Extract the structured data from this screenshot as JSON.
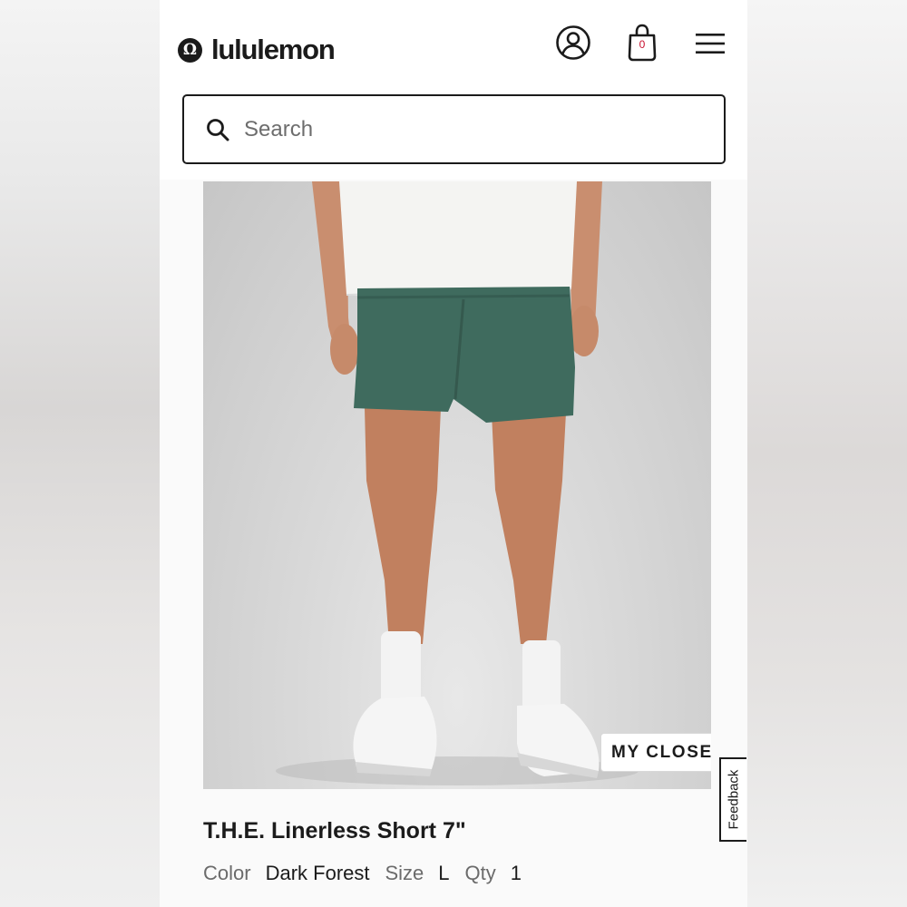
{
  "header": {
    "logo_mark": "Ω",
    "logo_text": "lululemon",
    "icons": [
      "account-icon",
      "bag-icon",
      "menu-icon"
    ],
    "bag_count": "0",
    "bag_count_color": "#c8102e"
  },
  "search": {
    "placeholder": "Search",
    "value": ""
  },
  "product": {
    "image_alt": "T.H.E. Linerless Short 7\"",
    "my_closet_label": "MY CLOSET",
    "title": "T.H.E. Linerless Short 7\"",
    "color_label": "Color",
    "color_value": "Dark Forest",
    "size_label": "Size",
    "size_value": "L",
    "qty_label": "Qty",
    "qty_value": "1",
    "shorts_color": "#3f6b5e"
  },
  "feedback": {
    "label": "Feedback"
  }
}
